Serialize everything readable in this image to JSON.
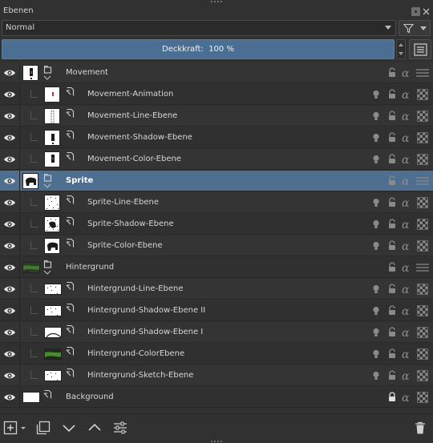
{
  "panel": {
    "title": "Ebenen"
  },
  "blend": {
    "mode": "Normal"
  },
  "opacity": {
    "label": "Deckkraft:",
    "value": "100 %"
  },
  "layers": [
    {
      "name": "Movement",
      "type": "group",
      "depth": 0
    },
    {
      "name": "Movement-Animation",
      "type": "paint",
      "depth": 1
    },
    {
      "name": "Movement-Line-Ebene",
      "type": "paint",
      "depth": 1
    },
    {
      "name": "Movement-Shadow-Ebene",
      "type": "paint",
      "depth": 1
    },
    {
      "name": "Movement-Color-Ebene",
      "type": "paint",
      "depth": 1
    },
    {
      "name": "Sprite",
      "type": "group",
      "depth": 0,
      "selected": true
    },
    {
      "name": "Sprite-Line-Ebene",
      "type": "paint",
      "depth": 1
    },
    {
      "name": "Sprite-Shadow-Ebene",
      "type": "paint",
      "depth": 1
    },
    {
      "name": "Sprite-Color-Ebene",
      "type": "paint",
      "depth": 1
    },
    {
      "name": "Hintergrund",
      "type": "group",
      "depth": 0
    },
    {
      "name": "Hintergrund-Line-Ebene",
      "type": "paint",
      "depth": 1
    },
    {
      "name": "Hintergrund-Shadow-Ebene II",
      "type": "paint",
      "depth": 1
    },
    {
      "name": "Hintergrund-Shadow-Ebene I",
      "type": "paint",
      "depth": 1
    },
    {
      "name": "Hintergrund-ColorEbene",
      "type": "paint",
      "depth": 1
    },
    {
      "name": "Hintergrund-Sketch-Ebene",
      "type": "paint",
      "depth": 1
    },
    {
      "name": "Background",
      "type": "paint",
      "depth": 0,
      "locked": true
    }
  ],
  "icons": {
    "visibility": "eye-icon",
    "lock": "lock-icon",
    "alpha": "alpha-lock-icon",
    "inherit": "inherit-alpha-icon",
    "onion": "onion-skin-icon"
  },
  "colors": {
    "selected_row": "#4f6f91",
    "opacity_bar": "#4b6f93"
  }
}
